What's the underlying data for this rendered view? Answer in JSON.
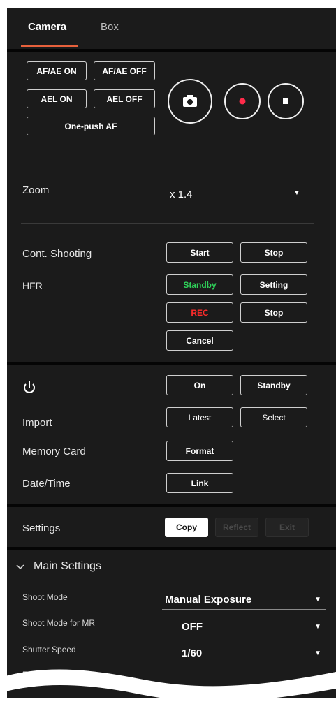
{
  "tabs": [
    {
      "label": "Camera"
    },
    {
      "label": "Box"
    }
  ],
  "camera_buttons": {
    "af_ae_on": "AF/AE ON",
    "af_ae_off": "AF/AE OFF",
    "ael_on": "AEL ON",
    "ael_off": "AEL OFF",
    "one_push_af": "One-push AF"
  },
  "zoom": {
    "label": "Zoom",
    "value": "x 1.4"
  },
  "cont_shooting": {
    "label": "Cont. Shooting",
    "start": "Start",
    "stop": "Stop"
  },
  "hfr": {
    "label": "HFR",
    "standby": "Standby",
    "setting": "Setting",
    "rec": "REC",
    "stop": "Stop",
    "cancel": "Cancel"
  },
  "power": {
    "on": "On",
    "standby": "Standby"
  },
  "import": {
    "label": "Import",
    "latest": "Latest",
    "select": "Select"
  },
  "memory_card": {
    "label": "Memory Card",
    "format": "Format"
  },
  "date_time": {
    "label": "Date/Time",
    "link": "Link"
  },
  "settings": {
    "label": "Settings",
    "copy": "Copy",
    "reflect": "Reflect",
    "exit": "Exit"
  },
  "main_settings": {
    "title": "Main Settings",
    "rows": [
      {
        "label": "Shoot Mode",
        "value": "Manual Exposure"
      },
      {
        "label": "Shoot Mode for MR",
        "value": "OFF"
      },
      {
        "label": "Shutter Speed",
        "value": "1/60"
      },
      {
        "label": "F-Number"
      }
    ]
  },
  "colors": {
    "accent": "#e8613c",
    "standby_green": "#2fd35a",
    "rec_red": "#ff2b2b",
    "record_dot": "#ff2b4a",
    "panel": "#1b1b1b"
  },
  "icons": [
    "camera-icon",
    "record-icon",
    "stop-icon",
    "power-icon",
    "chevron-down-icon",
    "dropdown-arrow-icon"
  ]
}
